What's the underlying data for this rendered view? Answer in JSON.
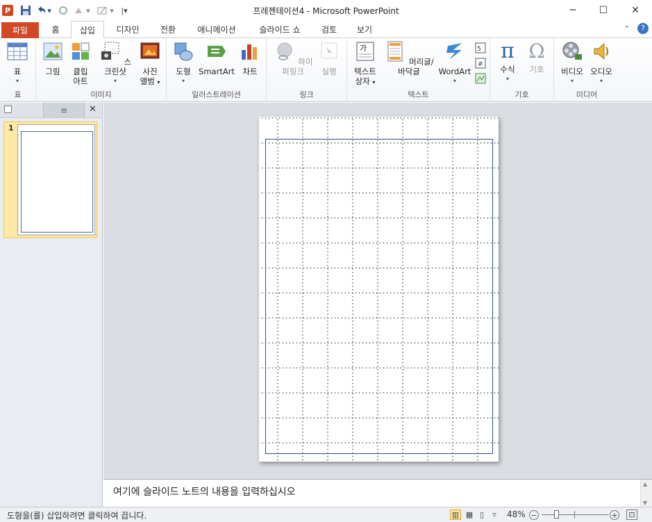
{
  "window": {
    "title": "프레젠테이션4 - Microsoft PowerPoint",
    "minimize": "─",
    "maximize": "☐",
    "close": "✕"
  },
  "tabs": [
    {
      "label": "파일"
    },
    {
      "label": "홈"
    },
    {
      "label": "삽입"
    },
    {
      "label": "디자인"
    },
    {
      "label": "전환"
    },
    {
      "label": "애니메이션"
    },
    {
      "label": "슬라이드 쇼"
    },
    {
      "label": "검토"
    },
    {
      "label": "보기"
    }
  ],
  "ribbon": {
    "groups": {
      "table": "표",
      "images": "이미지",
      "illustrations": "일러스트레이션",
      "links": "링크",
      "text": "텍스트",
      "symbols": "기호",
      "media": "미디어"
    },
    "buttons": {
      "table": "표",
      "picture": "그림",
      "clipart_1": "클립",
      "clipart_2": "아트",
      "screenshot": "스크린샷",
      "photoalbum_1": "사진",
      "photoalbum_2": "앨범",
      "shapes": "도형",
      "smartart": "SmartArt",
      "chart": "차트",
      "hyperlink": "하이퍼링크",
      "action": "실행",
      "textbox_1": "텍스트",
      "textbox_2": "상자",
      "headerfooter": "머리글/바닥글",
      "wordart": "WordArt",
      "equation": "수식",
      "symbol": "기호",
      "video": "비디오",
      "audio": "오디오"
    }
  },
  "leftpane": {
    "slide_number": "1",
    "close": "✕"
  },
  "notes": {
    "placeholder": "여기에 슬라이드 노트의 내용을 입력하십시오"
  },
  "status": {
    "message": "도형을(를) 삽입하려면 클릭하여 끕니다.",
    "zoom": "48%"
  }
}
